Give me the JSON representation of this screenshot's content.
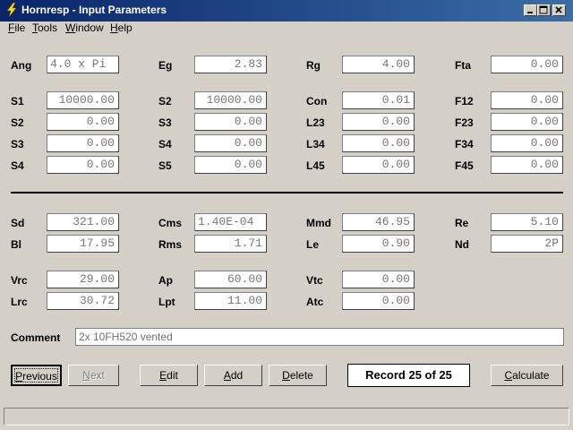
{
  "window": {
    "title": "Hornresp - Input Parameters"
  },
  "menu": [
    {
      "first": "F",
      "rest": "ile"
    },
    {
      "first": "T",
      "rest": "ools"
    },
    {
      "first": "W",
      "rest": "indow"
    },
    {
      "first": "H",
      "rest": "elp"
    }
  ],
  "params": {
    "ang": {
      "label": "Ang",
      "value": "4.0 x Pi"
    },
    "eg": {
      "label": "Eg",
      "value": "2.83"
    },
    "rg": {
      "label": "Rg",
      "value": "4.00"
    },
    "fta": {
      "label": "Fta",
      "value": "0.00"
    },
    "s1a": {
      "label": "S1",
      "value": "10000.00"
    },
    "s2a": {
      "label": "S2",
      "value": "0.00"
    },
    "s3a": {
      "label": "S3",
      "value": "0.00"
    },
    "s4a": {
      "label": "S4",
      "value": "0.00"
    },
    "s2b": {
      "label": "S2",
      "value": "10000.00"
    },
    "s3b": {
      "label": "S3",
      "value": "0.00"
    },
    "s4b": {
      "label": "S4",
      "value": "0.00"
    },
    "s5b": {
      "label": "S5",
      "value": "0.00"
    },
    "con": {
      "label": "Con",
      "value": "0.01"
    },
    "l23": {
      "label": "L23",
      "value": "0.00"
    },
    "l34": {
      "label": "L34",
      "value": "0.00"
    },
    "l45": {
      "label": "L45",
      "value": "0.00"
    },
    "f12": {
      "label": "F12",
      "value": "0.00"
    },
    "f23": {
      "label": "F23",
      "value": "0.00"
    },
    "f34": {
      "label": "F34",
      "value": "0.00"
    },
    "f45": {
      "label": "F45",
      "value": "0.00"
    },
    "sd": {
      "label": "Sd",
      "value": "321.00"
    },
    "bl": {
      "label": "Bl",
      "value": "17.95"
    },
    "cms": {
      "label": "Cms",
      "value": "1.40E-04"
    },
    "rms": {
      "label": "Rms",
      "value": "1.71"
    },
    "mmd": {
      "label": "Mmd",
      "value": "46.95"
    },
    "le": {
      "label": "Le",
      "value": "0.90"
    },
    "re": {
      "label": "Re",
      "value": "5.10"
    },
    "nd": {
      "label": "Nd",
      "value": "2P"
    },
    "vrc": {
      "label": "Vrc",
      "value": "29.00"
    },
    "lrc": {
      "label": "Lrc",
      "value": "30.72"
    },
    "ap": {
      "label": "Ap",
      "value": "60.00"
    },
    "lpt": {
      "label": "Lpt",
      "value": "11.00"
    },
    "vtc": {
      "label": "Vtc",
      "value": "0.00"
    },
    "atc": {
      "label": "Atc",
      "value": "0.00"
    }
  },
  "comment": {
    "label": "Comment",
    "value": "2x 10FH520 vented"
  },
  "buttons": {
    "previous": {
      "first": "P",
      "rest": "revious"
    },
    "next": {
      "first": "N",
      "rest": "ext"
    },
    "edit": {
      "first": "E",
      "rest": "dit"
    },
    "add": {
      "first": "A",
      "rest": "dd"
    },
    "delete": {
      "first": "D",
      "rest": "elete"
    },
    "calculate": {
      "first": "C",
      "rest": "alculate"
    }
  },
  "record": "Record 25 of 25",
  "colors": {
    "titlebar_start": "#0a246a",
    "titlebar_end": "#3a6ea5",
    "face": "#d4d0c8"
  }
}
